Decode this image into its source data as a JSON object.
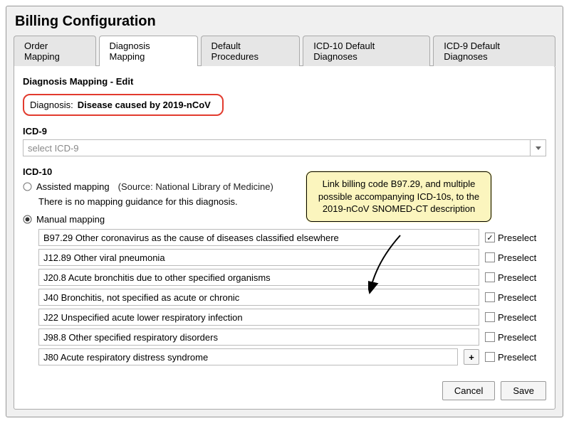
{
  "title": "Billing Configuration",
  "tabs": [
    {
      "label": "Order Mapping"
    },
    {
      "label": "Diagnosis Mapping"
    },
    {
      "label": "Default Procedures"
    },
    {
      "label": "ICD-10 Default Diagnoses"
    },
    {
      "label": "ICD-9 Default Diagnoses"
    }
  ],
  "active_tab": 1,
  "panel_heading": "Diagnosis Mapping - Edit",
  "diagnosis": {
    "label": "Diagnosis:",
    "value": "Disease caused by 2019-nCoV"
  },
  "icd9": {
    "label": "ICD-9",
    "placeholder": "select ICD-9"
  },
  "icd10": {
    "label": "ICD-10",
    "assisted": {
      "label": "Assisted mapping",
      "source": "(Source: National Library of Medicine)",
      "note": "There is no mapping guidance for this diagnosis."
    },
    "manual_label": "Manual mapping",
    "mapping_mode": "manual",
    "rows": [
      {
        "value": "B97.29 Other coronavirus as the cause of diseases classified elsewhere",
        "preselect": true
      },
      {
        "value": "J12.89 Other viral pneumonia",
        "preselect": false
      },
      {
        "value": "J20.8 Acute bronchitis due to other specified organisms",
        "preselect": false
      },
      {
        "value": "J40 Bronchitis, not specified as acute or chronic",
        "preselect": false
      },
      {
        "value": "J22 Unspecified acute lower respiratory infection",
        "preselect": false
      },
      {
        "value": "J98.8 Other specified respiratory disorders",
        "preselect": false
      },
      {
        "value": "J80 Acute respiratory distress syndrome",
        "preselect": false
      }
    ],
    "preselect_label": "Preselect",
    "add_label": "+"
  },
  "callout": "Link billing code B97.29, and multiple possible accompanying ICD-10s, to the 2019-nCoV SNOMED-CT description",
  "buttons": {
    "cancel": "Cancel",
    "save": "Save"
  }
}
